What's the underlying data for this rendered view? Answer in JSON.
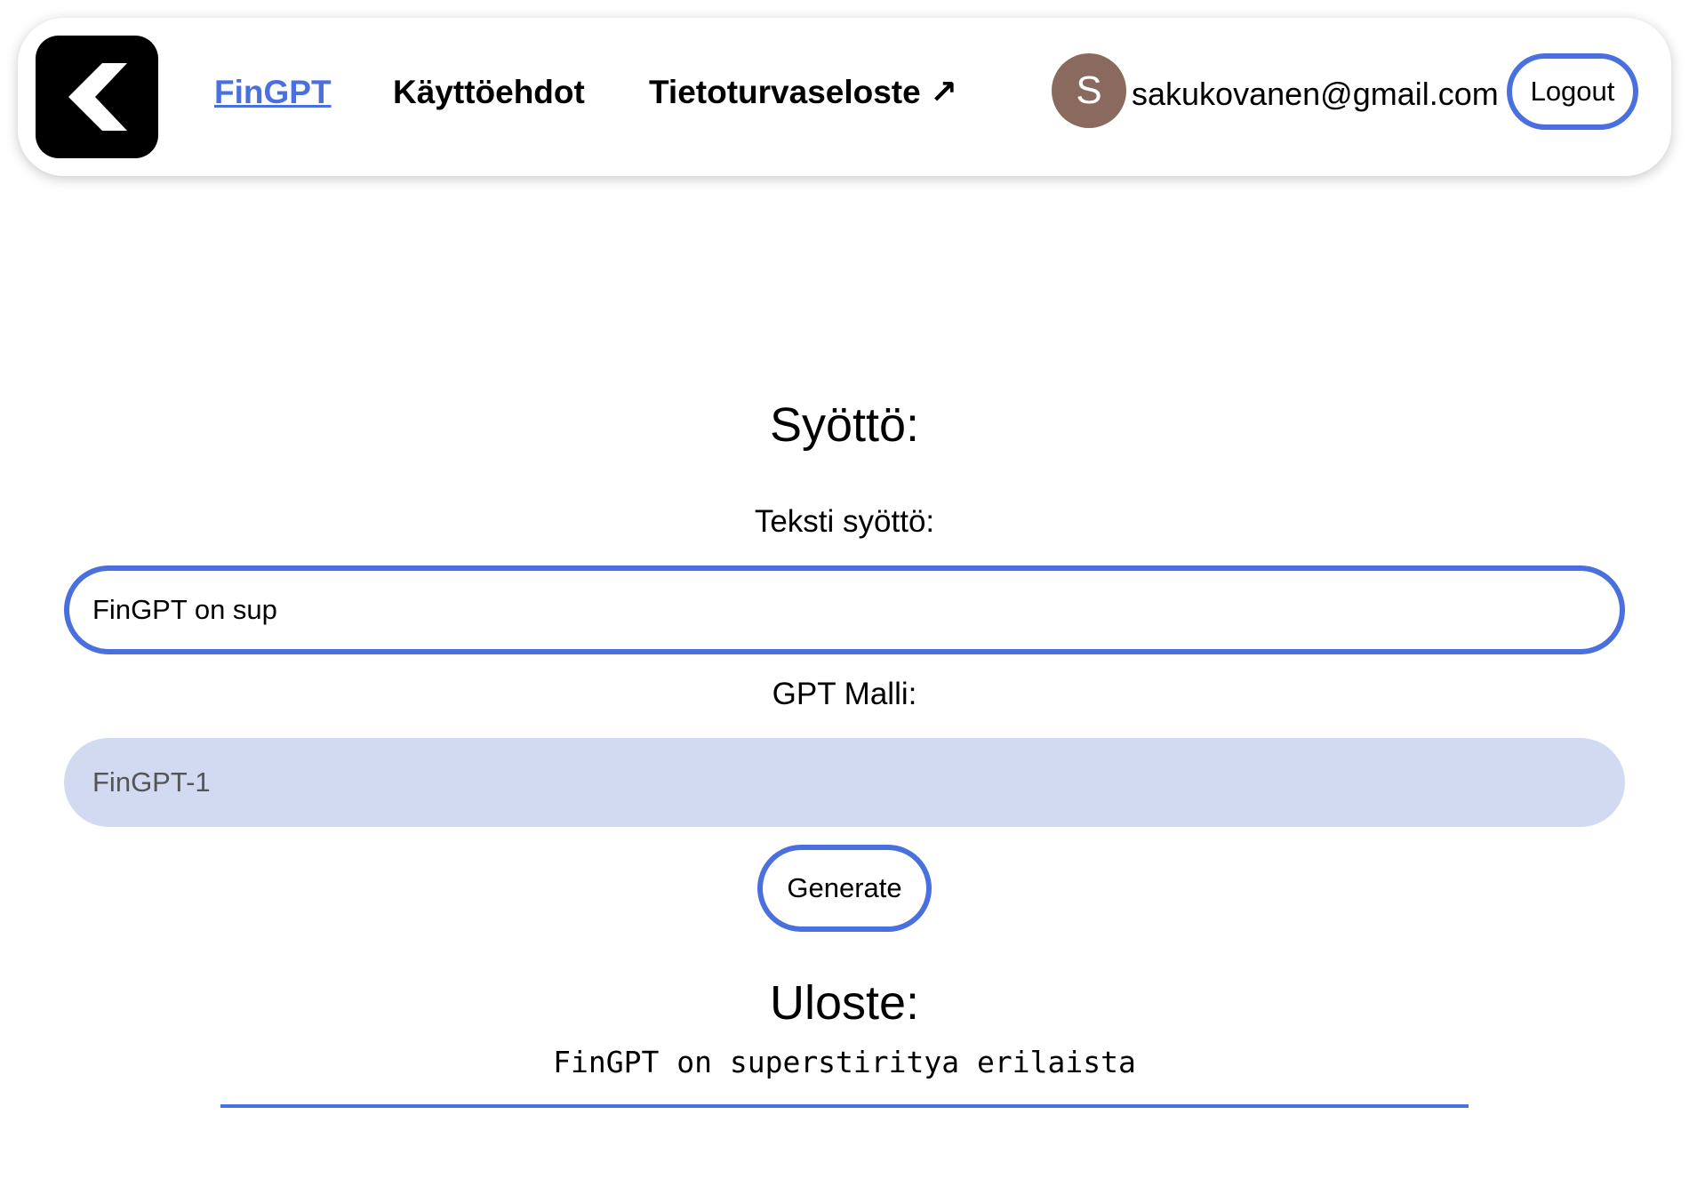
{
  "header": {
    "logo_icon": "chevron-left-icon",
    "nav": [
      {
        "label": "FinGPT",
        "active": true
      },
      {
        "label": "Käyttöehdot",
        "active": false
      },
      {
        "label": "Tietoturvaseloste ↗",
        "active": false
      }
    ],
    "user": {
      "avatar_initial": "S",
      "avatar_color": "#8a6a5e",
      "email": "sakukovanen@gmail.com"
    },
    "logout_label": "Logout"
  },
  "form": {
    "title": "Syöttö:",
    "text_label": "Teksti syöttö:",
    "text_value": "FinGPT on sup",
    "model_label": "GPT Malli:",
    "model_value": "FinGPT-1",
    "generate_label": "Generate"
  },
  "output": {
    "title": "Uloste:",
    "text": "FinGPT on superstiritya erilaista"
  },
  "colors": {
    "accent": "#4a6fde",
    "select_bg": "#d2daf2"
  }
}
